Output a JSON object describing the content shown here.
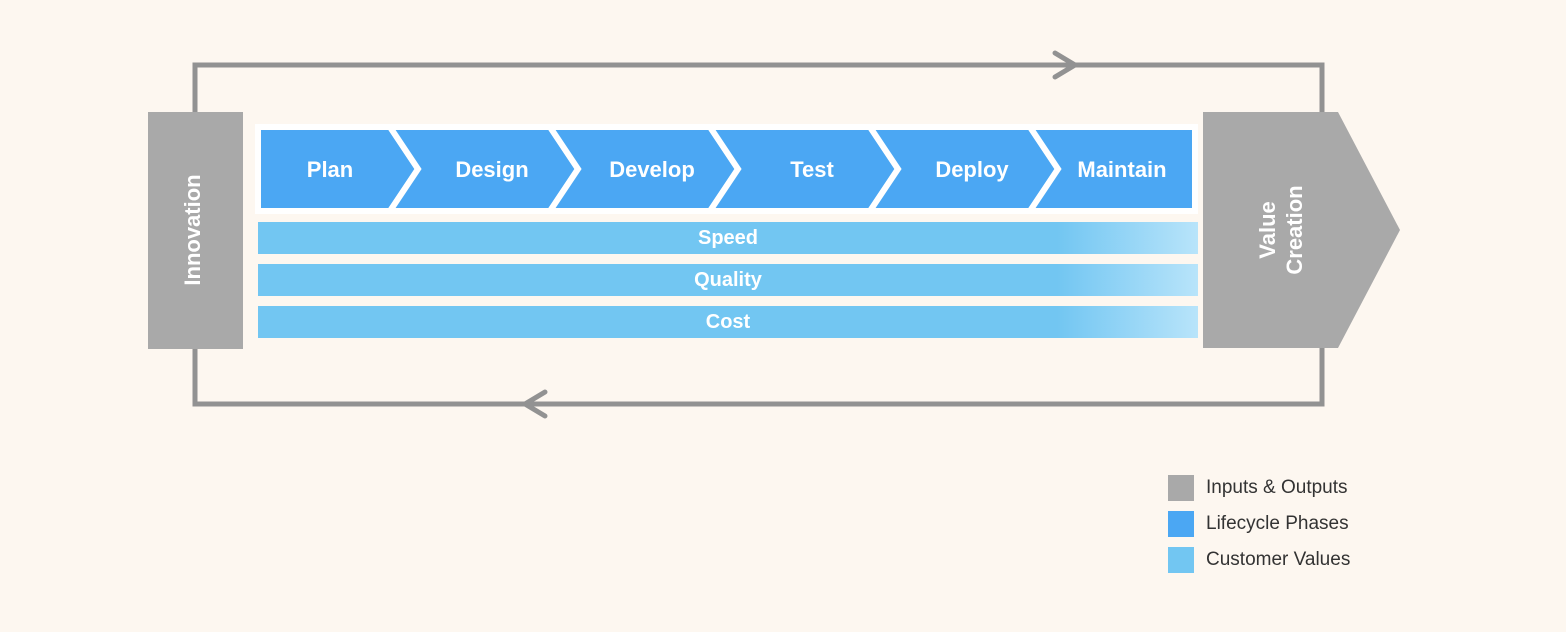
{
  "inputBlock": {
    "label": "Innovation"
  },
  "outputBlock": {
    "label_line1": "Value",
    "label_line2": "Creation"
  },
  "phases": [
    {
      "label": "Plan"
    },
    {
      "label": "Design"
    },
    {
      "label": "Develop"
    },
    {
      "label": "Test"
    },
    {
      "label": "Deploy"
    },
    {
      "label": "Maintain"
    }
  ],
  "values": [
    {
      "label": "Speed"
    },
    {
      "label": "Quality"
    },
    {
      "label": "Cost"
    }
  ],
  "legend": [
    {
      "label": "Inputs & Outputs",
      "class": "gray"
    },
    {
      "label": "Lifecycle Phases",
      "class": "phase"
    },
    {
      "label": "Customer Values",
      "class": "value"
    }
  ],
  "colors": {
    "gray": "#A9A9A9",
    "grayStroke": "#929292",
    "phase": "#4BA7F3",
    "value": "#72C6F2",
    "bg": "#FDF7F0"
  }
}
